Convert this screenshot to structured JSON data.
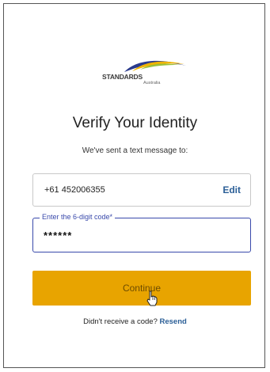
{
  "logo": {
    "name": "STANDARDS",
    "sub": "Australia"
  },
  "title": "Verify Your Identity",
  "subtitle": "We've sent a text message to:",
  "phone": {
    "value": "+61 452006355",
    "edit_label": "Edit"
  },
  "code_field": {
    "label": "Enter the 6-digit code*",
    "value": "******"
  },
  "continue_label": "Continue",
  "resend": {
    "prompt": "Didn't receive a code?",
    "link_label": "Resend"
  },
  "colors": {
    "accent_button": "#e8a400",
    "link": "#2b5f97",
    "focus_border": "#3949ab"
  },
  "icons": {
    "cursor": "hand-pointer-icon"
  }
}
